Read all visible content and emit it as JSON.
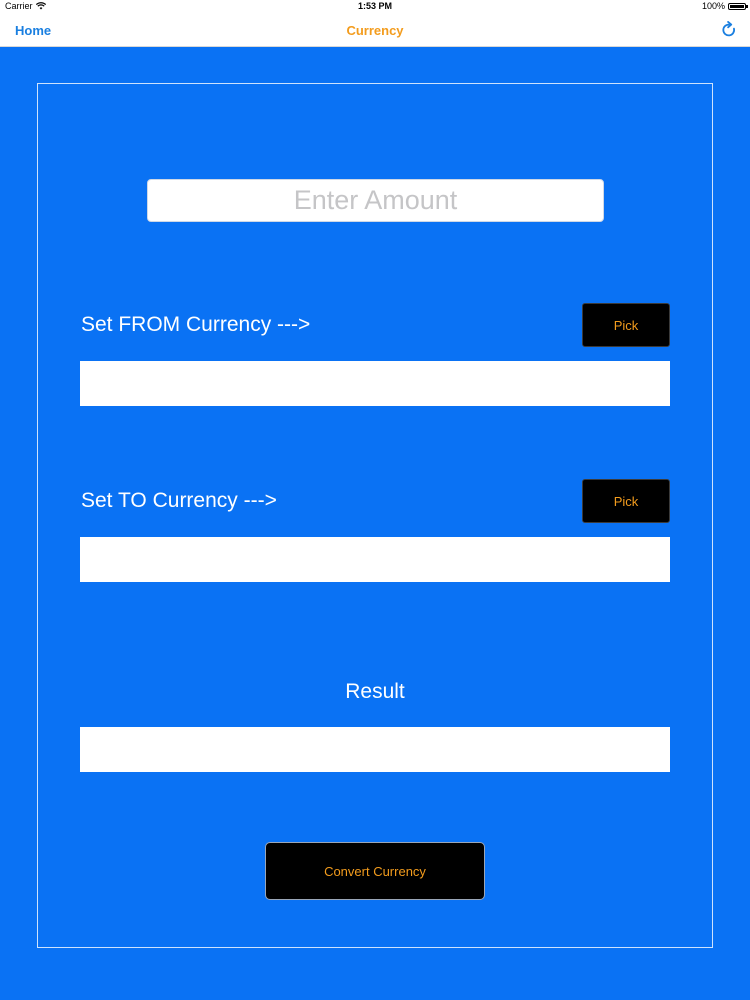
{
  "status_bar": {
    "carrier": "Carrier",
    "time": "1:53 PM",
    "battery": "100%"
  },
  "nav": {
    "back_label": "Home",
    "title": "Currency",
    "refresh_icon": "refresh-icon"
  },
  "colors": {
    "background": "#0a72f4",
    "accent_orange": "#f39c1d",
    "nav_link": "#1a7fe0",
    "button_bg": "#000000"
  },
  "form": {
    "amount_placeholder": "Enter Amount",
    "amount_value": "",
    "from_label": "Set FROM Currency --->",
    "from_pick_label": "Pick",
    "from_value": "",
    "to_label": "Set TO Currency --->",
    "to_pick_label": "Pick",
    "to_value": "",
    "result_label": "Result",
    "result_value": "",
    "convert_label": "Convert Currency"
  }
}
